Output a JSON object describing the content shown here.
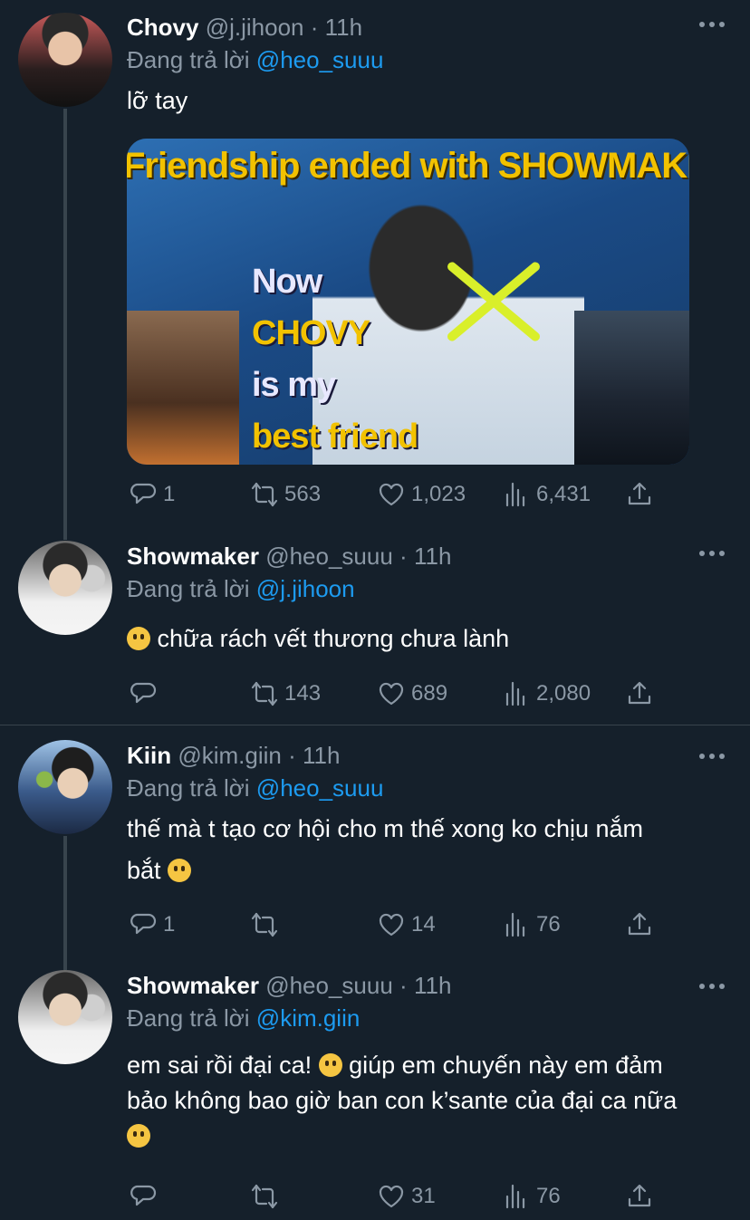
{
  "tweets": [
    {
      "name": "Chovy",
      "handle": "@j.jihoon",
      "time": "11h",
      "replying_prefix": "Đang trả lời",
      "replying_to": "@heo_suuu",
      "text": "lỡ tay",
      "media": {
        "title": "Friendship ended with SHOWMAKER",
        "caption_line1": "Now",
        "caption_line2": "CHOVY",
        "caption_line3": "is my",
        "caption_line4": "best friend"
      },
      "replies": "1",
      "retweets": "563",
      "likes": "1,023",
      "views": "6,431"
    },
    {
      "name": "Showmaker",
      "handle": "@heo_suuu",
      "time": "11h",
      "replying_prefix": "Đang trả lời",
      "replying_to": "@j.jihoon",
      "text": "chữa rách vết thương chưa lành",
      "replies": "",
      "retweets": "143",
      "likes": "689",
      "views": "2,080"
    },
    {
      "name": "Kiin",
      "handle": "@kim.giin",
      "time": "11h",
      "replying_prefix": "Đang trả lời",
      "replying_to": "@heo_suuu",
      "text_line1": "thế mà t tạo cơ hội cho m thế xong ko chịu nắm",
      "text_line2": "bắt",
      "replies": "1",
      "retweets": "",
      "likes": "14",
      "views": "76"
    },
    {
      "name": "Showmaker",
      "handle": "@heo_suuu",
      "time": "11h",
      "replying_prefix": "Đang trả lời",
      "replying_to": "@kim.giin",
      "text_line1": "em sai rồi đại ca!",
      "text_line1b": " giúp em chuyến này em đảm",
      "text_line2": "bảo không bao giờ ban con k’sante của đại ca nữa",
      "replies": "",
      "retweets": "",
      "likes": "31",
      "views": "76"
    }
  ],
  "separator": "·",
  "icons": [
    "more-icon",
    "reply-icon",
    "retweet-icon",
    "like-icon",
    "views-icon",
    "share-icon",
    "emoji-icon"
  ],
  "colors": {
    "background": "#15202b",
    "muted": "#8b98a5",
    "accent": "#1d9bf0",
    "line": "#38444d"
  }
}
